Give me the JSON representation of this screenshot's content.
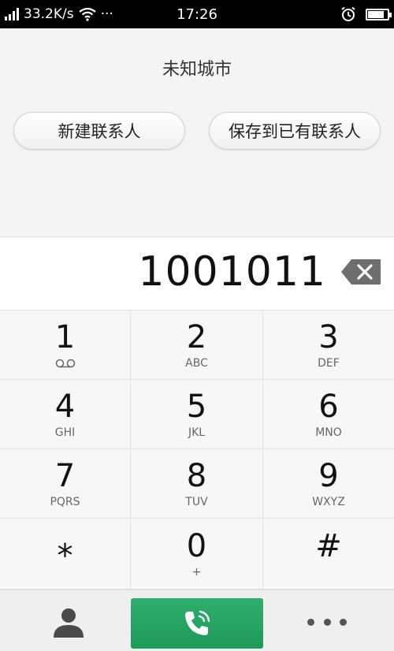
{
  "status_bar": {
    "net_speed": "33.2K/s",
    "dots": "···",
    "time": "17:26",
    "battery_level": 0.85
  },
  "location": "未知城市",
  "buttons": {
    "new_contact": "新建联系人",
    "save_existing": "保存到已有联系人"
  },
  "dialed_number": "1001011",
  "keypad": [
    {
      "digit": "1",
      "letters": ""
    },
    {
      "digit": "2",
      "letters": "ABC"
    },
    {
      "digit": "3",
      "letters": "DEF"
    },
    {
      "digit": "4",
      "letters": "GHI"
    },
    {
      "digit": "5",
      "letters": "JKL"
    },
    {
      "digit": "6",
      "letters": "MNO"
    },
    {
      "digit": "7",
      "letters": "PQRS"
    },
    {
      "digit": "8",
      "letters": "TUV"
    },
    {
      "digit": "9",
      "letters": "WXYZ"
    },
    {
      "digit": "⁎",
      "letters": ""
    },
    {
      "digit": "0",
      "letters": "+"
    },
    {
      "digit": "#",
      "letters": ""
    }
  ],
  "icons": {
    "voicemail": "voicemail-icon",
    "backspace": "backspace-icon",
    "contacts": "contacts-icon",
    "call": "phone-call-icon",
    "more": "more-dots-icon",
    "signal": "signal-icon",
    "wifi": "wifi-icon",
    "alarm": "alarm-clock-icon",
    "battery": "battery-icon"
  },
  "colors": {
    "call_button": "#23a35f",
    "status_bar": "#000000"
  }
}
